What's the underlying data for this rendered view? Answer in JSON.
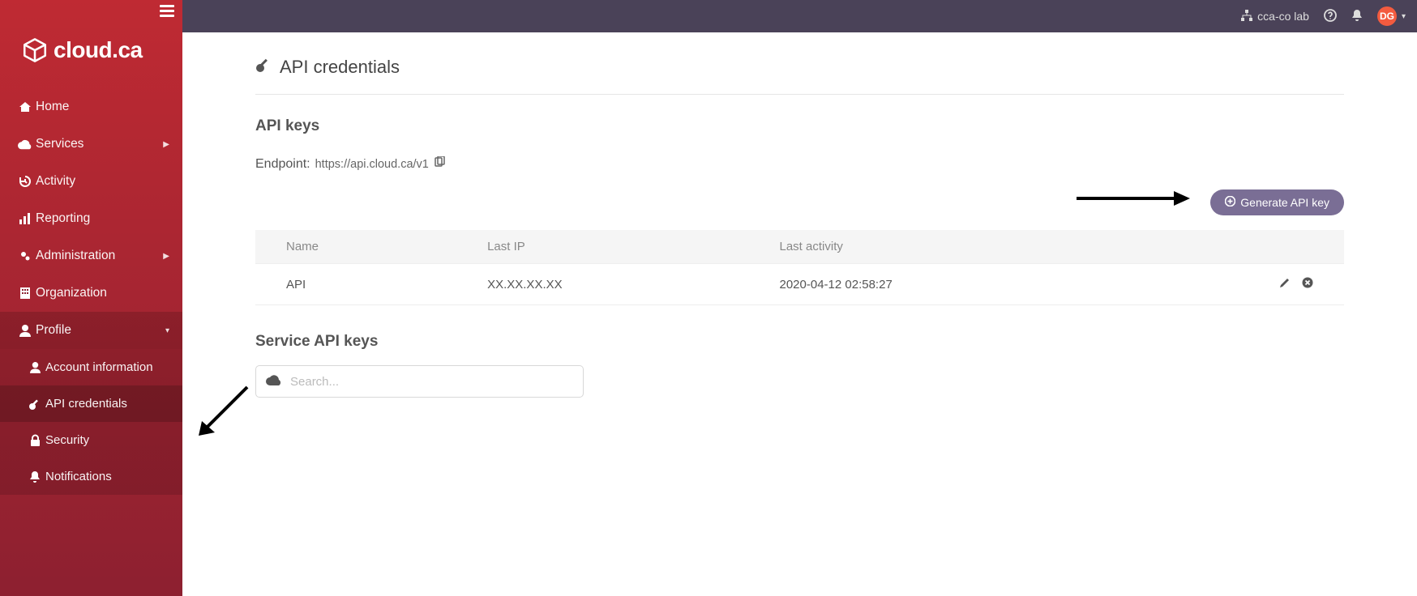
{
  "brand": {
    "name": "cloud.ca"
  },
  "sidebar": {
    "items": [
      {
        "label": "Home"
      },
      {
        "label": "Services"
      },
      {
        "label": "Activity"
      },
      {
        "label": "Reporting"
      },
      {
        "label": "Administration"
      },
      {
        "label": "Organization"
      },
      {
        "label": "Profile"
      }
    ],
    "profile_children": [
      {
        "label": "Account information"
      },
      {
        "label": "API credentials"
      },
      {
        "label": "Security"
      },
      {
        "label": "Notifications"
      }
    ]
  },
  "topbar": {
    "org_label": "cca-co lab",
    "user_initials": "DG"
  },
  "page": {
    "title": "API credentials",
    "api_keys_heading": "API keys",
    "endpoint_label": "Endpoint:",
    "endpoint_url": "https://api.cloud.ca/v1",
    "generate_button": "Generate API key",
    "table": {
      "columns": {
        "name": "Name",
        "last_ip": "Last IP",
        "last_activity": "Last activity"
      },
      "rows": [
        {
          "name": "API",
          "last_ip": "XX.XX.XX.XX",
          "last_activity": "2020-04-12 02:58:27"
        }
      ]
    },
    "service_keys_heading": "Service API keys",
    "search_placeholder": "Search..."
  }
}
